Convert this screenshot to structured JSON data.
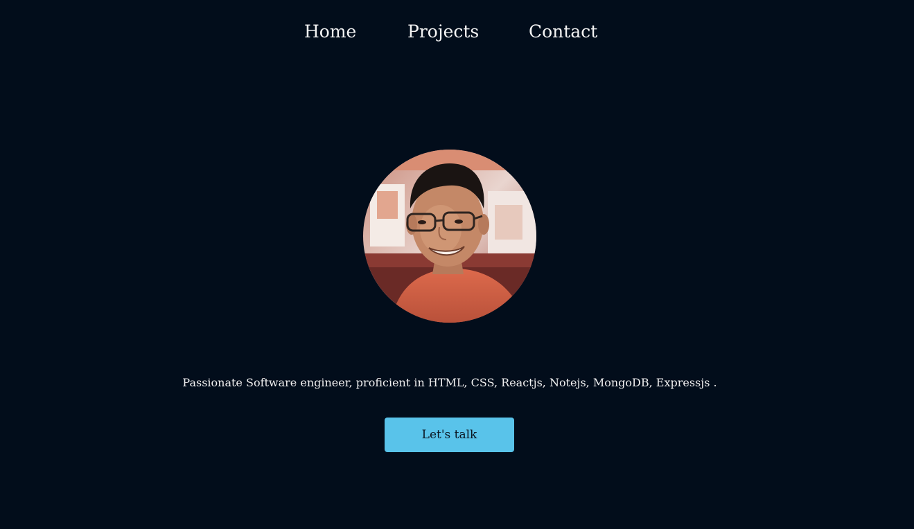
{
  "nav": {
    "items": [
      {
        "label": "Home"
      },
      {
        "label": "Projects"
      },
      {
        "label": "Contact"
      }
    ]
  },
  "hero": {
    "avatar_icon": "profile-photo",
    "tagline": "Passionate Software engineer, proficient in HTML, CSS, Reactjs, Notejs, MongoDB, Expressjs .",
    "cta_label": "Let's talk"
  },
  "colors": {
    "background": "#020d1b",
    "accent": "#59c3ea",
    "text": "#f2f2f2"
  }
}
